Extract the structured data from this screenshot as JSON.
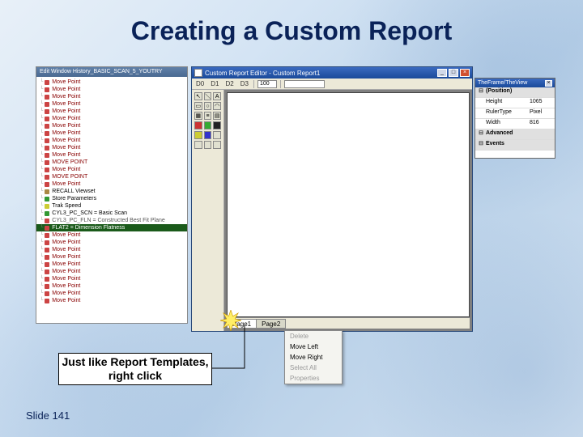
{
  "title": "Creating a Custom Report",
  "slide_number": "Slide 141",
  "callout_text": "Just like Report Templates, right click",
  "tree": {
    "header": "Edit Window  History_BASIC_SCAN_5_YOUTRY",
    "items": [
      {
        "label": "Move Point",
        "cls": "r"
      },
      {
        "label": "Move Point",
        "cls": "r"
      },
      {
        "label": "Move Point",
        "cls": "r"
      },
      {
        "label": "Move Point",
        "cls": "r"
      },
      {
        "label": "Move Point",
        "cls": "r"
      },
      {
        "label": "Move Point",
        "cls": "r"
      },
      {
        "label": "Move Point",
        "cls": "r"
      },
      {
        "label": "Move Point",
        "cls": "r"
      },
      {
        "label": "Move Point",
        "cls": "r"
      },
      {
        "label": "Move Point",
        "cls": "r"
      },
      {
        "label": "Move Point",
        "cls": "r"
      },
      {
        "label": "MOVE POINT",
        "cls": "y"
      },
      {
        "label": "Move Point",
        "cls": "r"
      },
      {
        "label": "MOVE POINT",
        "cls": "b"
      },
      {
        "label": "Move Point",
        "cls": "r"
      },
      {
        "label": "RECALL Viewset",
        "cls": "black",
        "dot": "b"
      },
      {
        "label": "Store Parameters",
        "cls": "black",
        "dot": "g"
      },
      {
        "label": "Trak Speed",
        "cls": "black",
        "dot": "y"
      },
      {
        "label": "CYL3_PC_SCN = Basic Scan",
        "cls": "black",
        "dot": "g"
      },
      {
        "label": "CYL3_PC_FLN = Constructed Best Fit Plane",
        "cls": "gray"
      },
      {
        "label": "FLAT2 = Dimension Flatness",
        "cls": "hl"
      },
      {
        "label": "Move Point",
        "cls": "r"
      },
      {
        "label": "Move Point",
        "cls": "r"
      },
      {
        "label": "Move Point",
        "cls": "r"
      },
      {
        "label": "Move Point",
        "cls": "r"
      },
      {
        "label": "Move Point",
        "cls": "r"
      },
      {
        "label": "Move Point",
        "cls": "r"
      },
      {
        "label": "Move Point",
        "cls": "r"
      },
      {
        "label": "Move Point",
        "cls": "r"
      },
      {
        "label": "Move Point",
        "cls": "r"
      },
      {
        "label": "Move Point",
        "cls": "r"
      }
    ]
  },
  "editor": {
    "title": "Custom Report Editor - Custom Report1",
    "zoom": "100",
    "tabs": [
      "Page1",
      "Page2"
    ]
  },
  "props": {
    "title": "TheFrame/TheView",
    "sections": [
      {
        "group": "(Position)"
      },
      {
        "row": [
          "Height",
          "1065"
        ]
      },
      {
        "row": [
          "RulerType",
          "Pixel"
        ]
      },
      {
        "row": [
          "Width",
          "816"
        ]
      },
      {
        "group": "Advanced"
      },
      {
        "group": "Events"
      }
    ]
  },
  "context_menu": {
    "items": [
      {
        "label": "Delete",
        "disabled": true
      },
      {
        "label": "Move Left",
        "disabled": false
      },
      {
        "label": "Move Right",
        "disabled": false
      },
      {
        "label": "Select All",
        "disabled": true
      },
      {
        "label": "Properties",
        "disabled": true
      }
    ]
  }
}
